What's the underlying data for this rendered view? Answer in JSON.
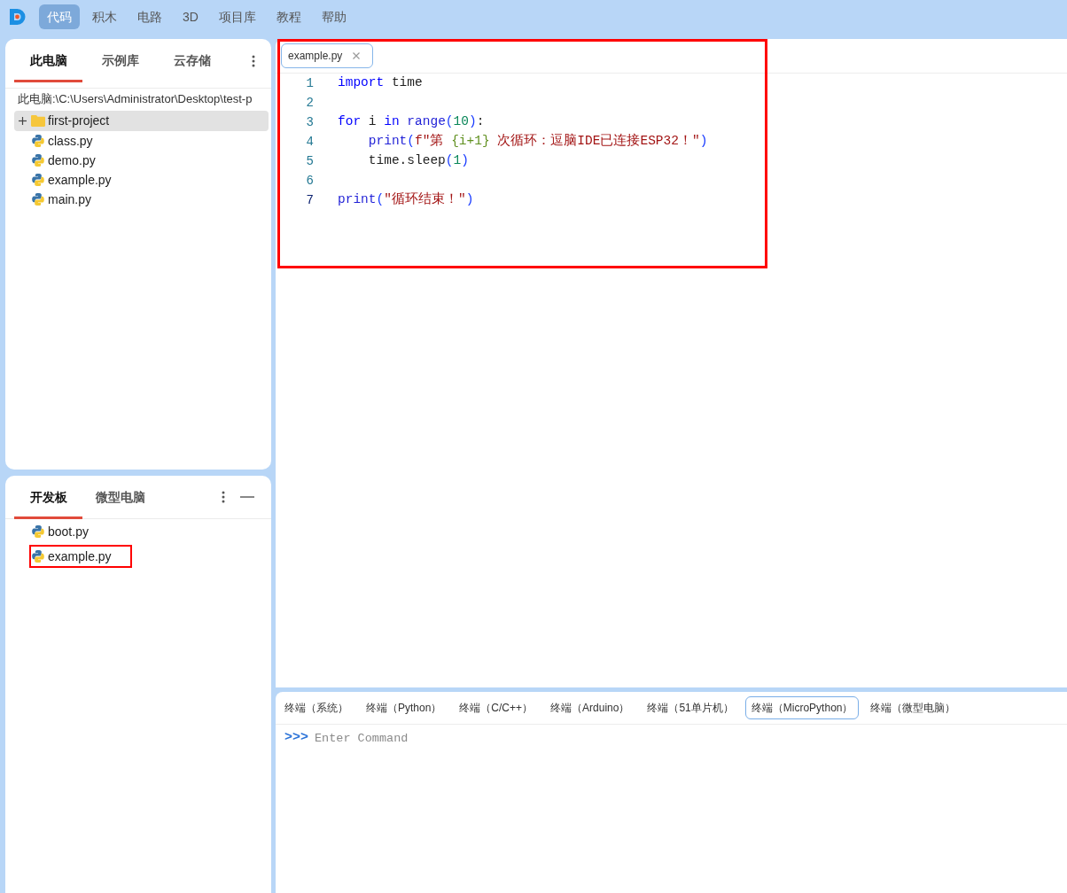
{
  "menu": {
    "items": [
      {
        "label": "代码",
        "selected": true
      },
      {
        "label": "积木",
        "selected": false
      },
      {
        "label": "电路",
        "selected": false
      },
      {
        "label": "3D",
        "selected": false
      },
      {
        "label": "项目库",
        "selected": false
      },
      {
        "label": "教程",
        "selected": false
      },
      {
        "label": "帮助",
        "selected": false
      }
    ]
  },
  "explorer": {
    "tabs": [
      {
        "label": "此电脑",
        "selected": true
      },
      {
        "label": "示例库",
        "selected": false
      },
      {
        "label": "云存储",
        "selected": false
      }
    ],
    "path": "此电脑:\\C:\\Users\\Administrator\\Desktop\\test-p",
    "files": [
      {
        "kind": "folder",
        "name": "first-project",
        "expanded": false,
        "selected": true
      },
      {
        "kind": "file",
        "name": "class.py",
        "selected": false
      },
      {
        "kind": "file",
        "name": "demo.py",
        "selected": false
      },
      {
        "kind": "file",
        "name": "example.py",
        "selected": false
      },
      {
        "kind": "file",
        "name": "main.py",
        "selected": false
      }
    ]
  },
  "board": {
    "tabs": [
      {
        "label": "开发板",
        "selected": true
      },
      {
        "label": "微型电脑",
        "selected": false
      }
    ],
    "files": [
      {
        "name": "boot.py",
        "highlighted": false
      },
      {
        "name": "example.py",
        "highlighted": true
      }
    ]
  },
  "editor": {
    "highlighted": true,
    "tabs": [
      {
        "label": "example.py",
        "selected": true
      }
    ],
    "lines": [
      {
        "number": "1",
        "active": false,
        "tokens": [
          {
            "kind": "keyword",
            "text": "import"
          },
          {
            "kind": "plain",
            "text": " time"
          }
        ]
      },
      {
        "number": "2",
        "active": false
      },
      {
        "number": "3",
        "active": false,
        "tokens": [
          {
            "kind": "keyword",
            "text": "for"
          },
          {
            "kind": "plain",
            "text": " i "
          },
          {
            "kind": "keyword",
            "text": "in"
          },
          {
            "kind": "builtin",
            "text": " range"
          },
          {
            "kind": "bracket",
            "text": "("
          },
          {
            "kind": "number",
            "text": "10"
          },
          {
            "kind": "bracket",
            "text": ")"
          },
          {
            "kind": "plain",
            "text": ":"
          }
        ]
      },
      {
        "number": "4",
        "active": false,
        "tokens": [
          {
            "kind": "builtin",
            "text": "    print"
          },
          {
            "kind": "bracket",
            "text": "("
          },
          {
            "kind": "string",
            "text": "f\"第 "
          },
          {
            "kind": "interp",
            "text": "{i+1}"
          },
          {
            "kind": "string",
            "text": " 次循环：逗脑IDE已连接ESP32！\""
          },
          {
            "kind": "bracket",
            "text": ")"
          }
        ]
      },
      {
        "number": "5",
        "active": false,
        "tokens": [
          {
            "kind": "plain",
            "text": "    time.sleep"
          },
          {
            "kind": "bracket",
            "text": "("
          },
          {
            "kind": "number",
            "text": "1"
          },
          {
            "kind": "bracket",
            "text": ")"
          }
        ]
      },
      {
        "number": "6",
        "active": false
      },
      {
        "number": "7",
        "active": true,
        "tokens": [
          {
            "kind": "builtin",
            "text": "print"
          },
          {
            "kind": "bracket",
            "text": "("
          },
          {
            "kind": "string",
            "text": "\"循环结束！\""
          },
          {
            "kind": "bracket",
            "text": ")"
          }
        ]
      }
    ]
  },
  "terminal": {
    "tabs": [
      {
        "label": "终端（系统）",
        "selected": false
      },
      {
        "label": "终端（Python）",
        "selected": false
      },
      {
        "label": "终端（C/C++）",
        "selected": false
      },
      {
        "label": "终端（Arduino）",
        "selected": false
      },
      {
        "label": "终端（51单片机）",
        "selected": false
      },
      {
        "label": "终端（MicroPython）",
        "selected": true
      },
      {
        "label": "终端（微型电脑）",
        "selected": false
      }
    ],
    "prompt": ">>>",
    "placeholder": "Enter Command"
  }
}
